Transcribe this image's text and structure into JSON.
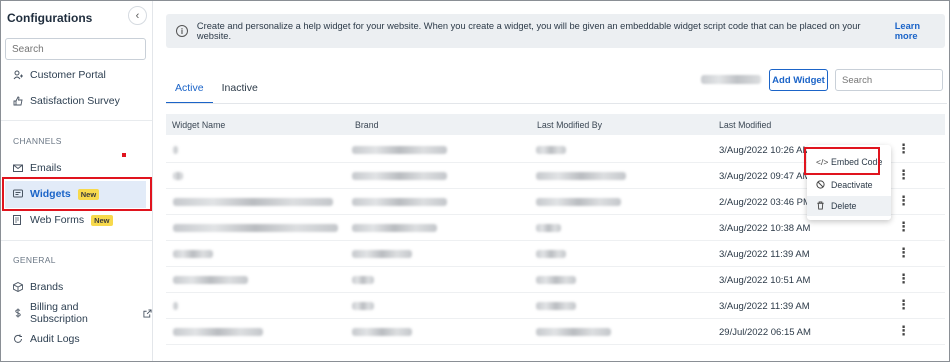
{
  "sidebar": {
    "title": "Configurations",
    "collapse_icon": "chevron-left-icon",
    "search_placeholder": "Search",
    "items_top": [
      {
        "label": "Customer Portal",
        "icon": "user-portal-icon"
      },
      {
        "label": "Satisfaction Survey",
        "icon": "thumbs-up-icon"
      }
    ],
    "section_channels": "CHANNELS",
    "channels": [
      {
        "label": "Emails",
        "icon": "mail-icon"
      },
      {
        "label": "Widgets",
        "icon": "widget-icon",
        "badge": "New",
        "active": true
      },
      {
        "label": "Web Forms",
        "icon": "form-icon",
        "badge": "New"
      }
    ],
    "section_general": "GENERAL",
    "general": [
      {
        "label": "Brands",
        "icon": "cube-icon"
      },
      {
        "label": "Billing and Subscription",
        "icon": "dollar-icon",
        "external_icon": "external-link-icon"
      },
      {
        "label": "Audit Logs",
        "icon": "refresh-icon"
      }
    ]
  },
  "info": {
    "text": "Create and personalize a help widget for your website. When you create a widget, you will be given an embeddable widget script code that can be placed on your website.",
    "link": "Learn more"
  },
  "tabs": [
    {
      "label": "Active",
      "active": true
    },
    {
      "label": "Inactive",
      "active": false
    }
  ],
  "toolbar": {
    "add_widget_label": "Add Widget",
    "search_placeholder": "Search"
  },
  "table": {
    "headers": [
      "Widget Name",
      "Brand",
      "Last Modified By",
      "Last Modified"
    ],
    "rows": [
      {
        "last_modified": "3/Aug/2022 10:26 AM"
      },
      {
        "last_modified": "3/Aug/2022 09:47 AM"
      },
      {
        "last_modified": "2/Aug/2022 03:46 PM"
      },
      {
        "last_modified": "3/Aug/2022 10:38 AM"
      },
      {
        "last_modified": "3/Aug/2022 11:39 AM"
      },
      {
        "last_modified": "3/Aug/2022 10:51 AM"
      },
      {
        "last_modified": "3/Aug/2022 11:39 AM"
      },
      {
        "last_modified": "29/Jul/2022 06:15 AM"
      }
    ]
  },
  "row_menu": [
    {
      "label": "Embed Code",
      "icon": "code-icon"
    },
    {
      "label": "Deactivate",
      "icon": "ban-icon"
    },
    {
      "label": "Delete",
      "icon": "trash-icon"
    }
  ],
  "colors": {
    "accent": "#1b64c8",
    "highlight": "#e0141e",
    "badge": "#f7d94c"
  }
}
